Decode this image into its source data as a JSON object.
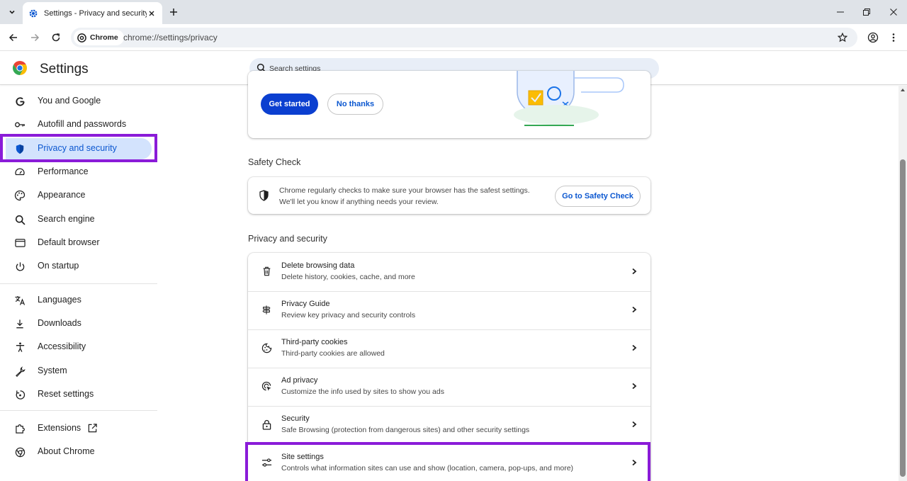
{
  "tab": {
    "title": "Settings - Privacy and security"
  },
  "omnibox": {
    "chip": "Chrome",
    "url": "chrome://settings/privacy"
  },
  "header": {
    "title": "Settings",
    "search_placeholder": "Search settings"
  },
  "sidebar": {
    "items": [
      {
        "label": "You and Google",
        "icon": "google-g-icon"
      },
      {
        "label": "Autofill and passwords",
        "icon": "key-icon"
      },
      {
        "label": "Privacy and security",
        "icon": "shield-icon",
        "active": true
      },
      {
        "label": "Performance",
        "icon": "speedometer-icon"
      },
      {
        "label": "Appearance",
        "icon": "palette-icon"
      },
      {
        "label": "Search engine",
        "icon": "search-icon"
      },
      {
        "label": "Default browser",
        "icon": "browser-window-icon"
      },
      {
        "label": "On startup",
        "icon": "power-icon"
      },
      {
        "label": "Languages",
        "icon": "translate-icon"
      },
      {
        "label": "Downloads",
        "icon": "download-icon"
      },
      {
        "label": "Accessibility",
        "icon": "accessibility-icon"
      },
      {
        "label": "System",
        "icon": "wrench-icon"
      },
      {
        "label": "Reset settings",
        "icon": "reset-icon"
      },
      {
        "label": "Extensions",
        "icon": "puzzle-icon"
      },
      {
        "label": "About Chrome",
        "icon": "chrome-icon"
      }
    ]
  },
  "promo": {
    "primary_button": "Get started",
    "secondary_button": "No thanks"
  },
  "safety_check": {
    "section_title": "Safety Check",
    "line1": "Chrome regularly checks to make sure your browser has the safest settings.",
    "line2": "We'll let you know if anything needs your review.",
    "button": "Go to Safety Check"
  },
  "privacy": {
    "section_title": "Privacy and security",
    "rows": [
      {
        "title": "Delete browsing data",
        "subtitle": "Delete history, cookies, cache, and more",
        "icon": "trash-icon"
      },
      {
        "title": "Privacy Guide",
        "subtitle": "Review key privacy and security controls",
        "icon": "signpost-icon"
      },
      {
        "title": "Third-party cookies",
        "subtitle": "Third-party cookies are allowed",
        "icon": "cookie-icon"
      },
      {
        "title": "Ad privacy",
        "subtitle": "Customize the info used by sites to show you ads",
        "icon": "ad-target-icon"
      },
      {
        "title": "Security",
        "subtitle": "Safe Browsing (protection from dangerous sites) and other security settings",
        "icon": "lock-icon"
      },
      {
        "title": "Site settings",
        "subtitle": "Controls what information sites can use and show (location, camera, pop-ups, and more)",
        "icon": "sliders-icon"
      }
    ]
  },
  "colors": {
    "accent": "#0b57d0",
    "highlight": "#8a1bd8",
    "primary_button": "#0b3fd0"
  }
}
